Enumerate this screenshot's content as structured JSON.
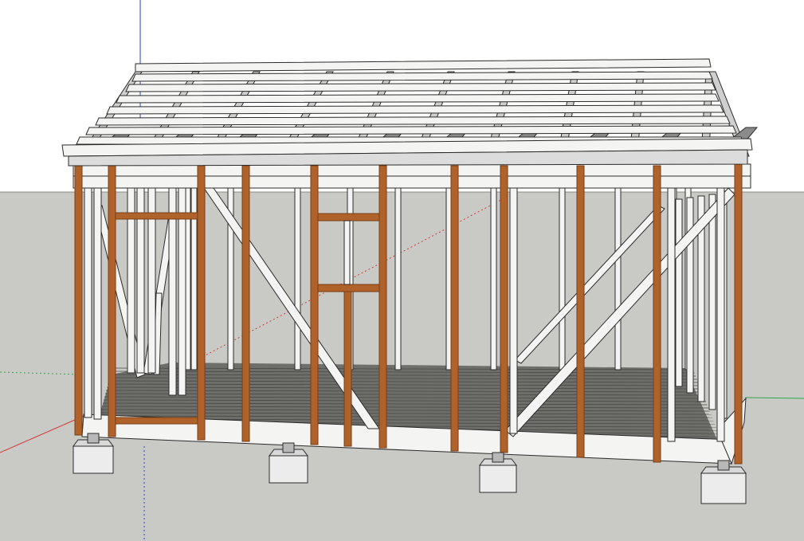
{
  "colors": {
    "sky": "#ffffff",
    "ground": "#c9c9c5",
    "ground_line": "#8a8a85",
    "floor": "#6e6e6b",
    "floor_joint": "#4a4a47",
    "lumber_white": "#f4f4f2",
    "lumber_edge": "#2b2b2b",
    "stud_orange": "#b0622b",
    "stud_orange_dark": "#7a3f17",
    "rafter_gray": "#cfcfcf",
    "footing": "#ececec",
    "axis_red": "#d23a3a",
    "axis_green": "#2fa84a",
    "axis_blue": "#2a3fd6"
  },
  "footings": [
    {
      "label": "footing-front-left"
    },
    {
      "label": "footing-front-mid-left"
    },
    {
      "label": "footing-front-mid-right"
    },
    {
      "label": "footing-front-right"
    }
  ]
}
